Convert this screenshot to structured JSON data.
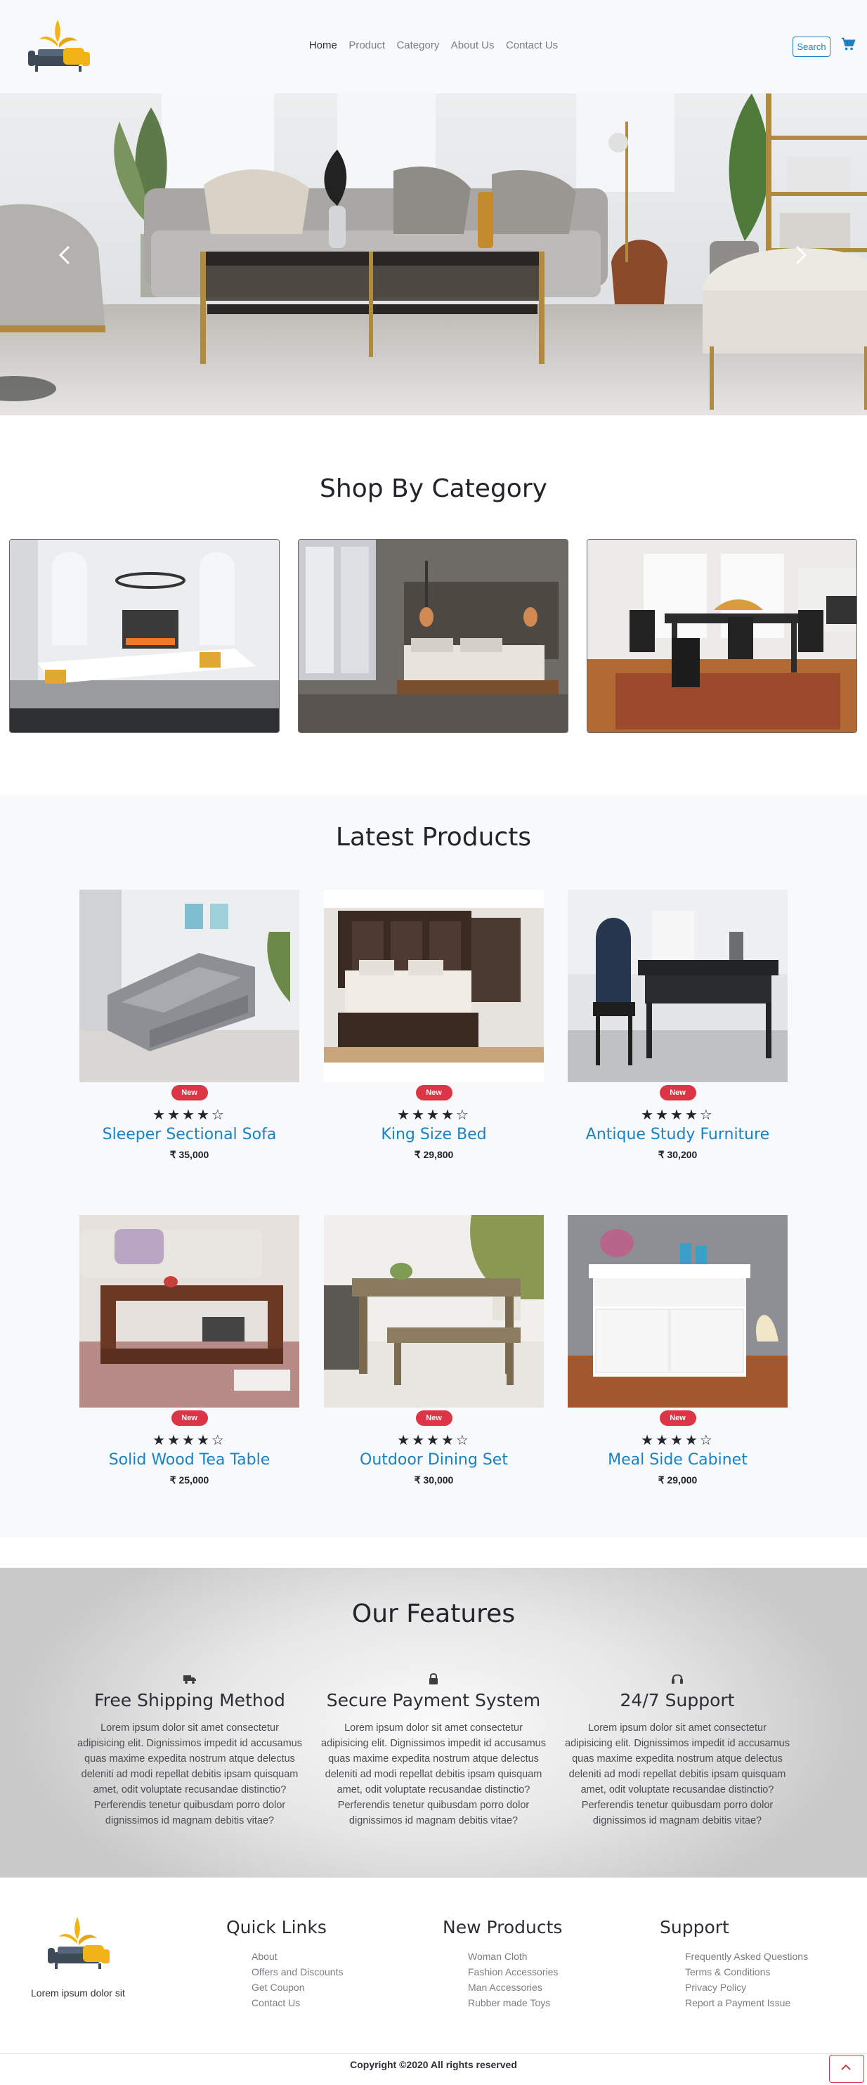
{
  "nav": {
    "items": [
      {
        "label": "Home",
        "active": true
      },
      {
        "label": "Product",
        "active": false
      },
      {
        "label": "Category",
        "active": false
      },
      {
        "label": "About Us",
        "active": false
      },
      {
        "label": "Contact Us",
        "active": false
      }
    ],
    "search_label": "Search",
    "cart_icon": "cart-icon",
    "accent": "#1a82c4"
  },
  "hero": {
    "prev_icon": "chevron-left-icon",
    "next_icon": "chevron-right-icon"
  },
  "category": {
    "title": "Shop By Category",
    "cards": [
      {
        "name": "living-room"
      },
      {
        "name": "bedroom"
      },
      {
        "name": "dining-room"
      }
    ]
  },
  "latest": {
    "title": "Latest Products",
    "products": [
      {
        "name": "Sleeper Sectional Sofa",
        "price": "₹ 35,000",
        "badge": "New",
        "stars": "★★★★☆"
      },
      {
        "name": "King Size Bed",
        "price": "₹ 29,800",
        "badge": "New",
        "stars": "★★★★☆"
      },
      {
        "name": "Antique Study Furniture",
        "price": "₹ 30,200",
        "badge": "New",
        "stars": "★★★★☆"
      },
      {
        "name": "Solid Wood Tea Table",
        "price": "₹ 25,000",
        "badge": "New",
        "stars": "★★★★☆"
      },
      {
        "name": "Outdoor Dining Set",
        "price": "₹ 30,000",
        "badge": "New",
        "stars": "★★★★☆"
      },
      {
        "name": "Meal Side Cabinet",
        "price": "₹ 29,000",
        "badge": "New",
        "stars": "★★★★☆"
      }
    ],
    "badge_color": "#dc3545"
  },
  "features": {
    "title": "Our Features",
    "items": [
      {
        "icon": "truck-icon",
        "title": "Free Shipping Method",
        "text": "Lorem ipsum dolor sit amet consectetur adipisicing elit. Dignissimos impedit id accusamus quas maxime expedita nostrum atque delectus deleniti ad modi repellat debitis ipsam quisquam amet, odit voluptate recusandae distinctio? Perferendis tenetur quibusdam porro dolor dignissimos id magnam debitis vitae?"
      },
      {
        "icon": "lock-icon",
        "title": "Secure Payment System",
        "text": "Lorem ipsum dolor sit amet consectetur adipisicing elit. Dignissimos impedit id accusamus quas maxime expedita nostrum atque delectus deleniti ad modi repellat debitis ipsam quisquam amet, odit voluptate recusandae distinctio? Perferendis tenetur quibusdam porro dolor dignissimos id magnam debitis vitae?"
      },
      {
        "icon": "headset-icon",
        "title": "24/7 Support",
        "text": "Lorem ipsum dolor sit amet consectetur adipisicing elit. Dignissimos impedit id accusamus quas maxime expedita nostrum atque delectus deleniti ad modi repellat debitis ipsam quisquam amet, odit voluptate recusandae distinctio? Perferendis tenetur quibusdam porro dolor dignissimos id magnam debitis vitae?"
      }
    ]
  },
  "footer": {
    "tagline": "Lorem ipsum dolor sit",
    "columns": [
      {
        "title": "Quick Links",
        "links": [
          "About",
          "Offers and Discounts",
          "Get Coupon",
          "Contact Us"
        ]
      },
      {
        "title": "New Products",
        "links": [
          "Woman Cloth",
          "Fashion Accessories",
          "Man Accessories",
          "Rubber made Toys"
        ]
      },
      {
        "title": "Support",
        "links": [
          "Frequently Asked Questions",
          "Terms & Conditions",
          "Privacy Policy",
          "Report a Payment Issue"
        ]
      }
    ],
    "copyright": "Copyright ©2020 All rights reserved",
    "scroll_top_icon": "chevron-up-icon"
  }
}
